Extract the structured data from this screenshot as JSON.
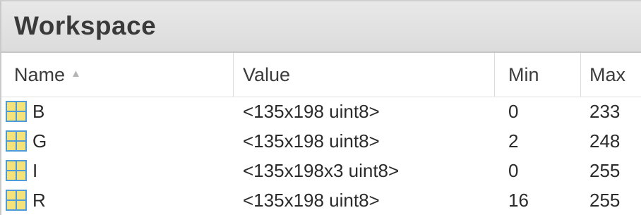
{
  "panel": {
    "title": "Workspace"
  },
  "columns": {
    "name": "Name",
    "value": "Value",
    "min": "Min",
    "max": "Max"
  },
  "sort": {
    "column": "Name",
    "direction": "ascending",
    "icon": "sort-ascending-icon"
  },
  "variables": [
    {
      "name": "B",
      "value": "<135x198 uint8>",
      "min": "0",
      "max": "233",
      "icon": "matrix-variable-icon"
    },
    {
      "name": "G",
      "value": "<135x198 uint8>",
      "min": "2",
      "max": "248",
      "icon": "matrix-variable-icon"
    },
    {
      "name": "I",
      "value": "<135x198x3 uint8>",
      "min": "0",
      "max": "255",
      "icon": "matrix-variable-icon"
    },
    {
      "name": "R",
      "value": "<135x198 uint8>",
      "min": "16",
      "max": "255",
      "icon": "matrix-variable-icon"
    }
  ],
  "colors": {
    "icon_fill": "#f4e27a",
    "icon_grid": "#4f9bd9"
  }
}
